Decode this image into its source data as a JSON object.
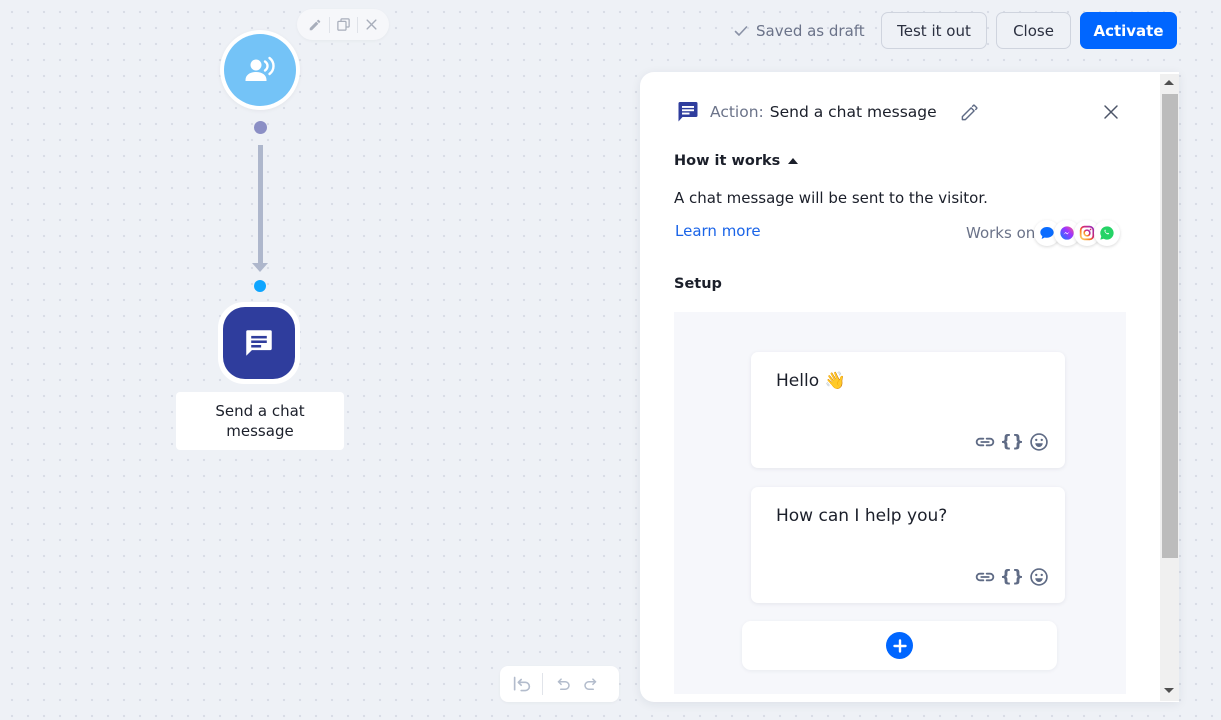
{
  "canvas": {
    "node_toolbar": {
      "icons": [
        "pencil-icon",
        "duplicate-icon",
        "close-icon"
      ]
    },
    "trigger_node": {
      "icon": "visitor-speaking-icon",
      "color": "#74c3f7"
    },
    "action_node": {
      "icon": "chat-message-icon",
      "color": "#2f3d9d",
      "label": "Send a chat message"
    },
    "history_toolbar": {
      "icons": [
        "reset-icon",
        "undo-icon",
        "redo-icon"
      ]
    }
  },
  "topbar": {
    "status": "Saved as draft",
    "status_icon": "check-icon",
    "test_label": "Test it out",
    "close_label": "Close",
    "activate_label": "Activate",
    "accent": "#0066ff"
  },
  "panel": {
    "header_prefix": "Action:",
    "header_title": "Send a chat message",
    "how_it_works_label": "How it works",
    "description": "A chat message will be sent to the visitor.",
    "learn_more": "Learn more",
    "works_on_label": "Works on",
    "channels": [
      "livechat",
      "messenger",
      "instagram",
      "whatsapp"
    ],
    "setup_label": "Setup",
    "messages": [
      {
        "text": "Hello 👋",
        "tools": [
          "link-icon",
          "variables-icon",
          "emoji-icon"
        ]
      },
      {
        "text": "How can I help you?",
        "tools": [
          "link-icon",
          "variables-icon",
          "emoji-icon"
        ]
      }
    ],
    "braces_glyph": "{}"
  }
}
